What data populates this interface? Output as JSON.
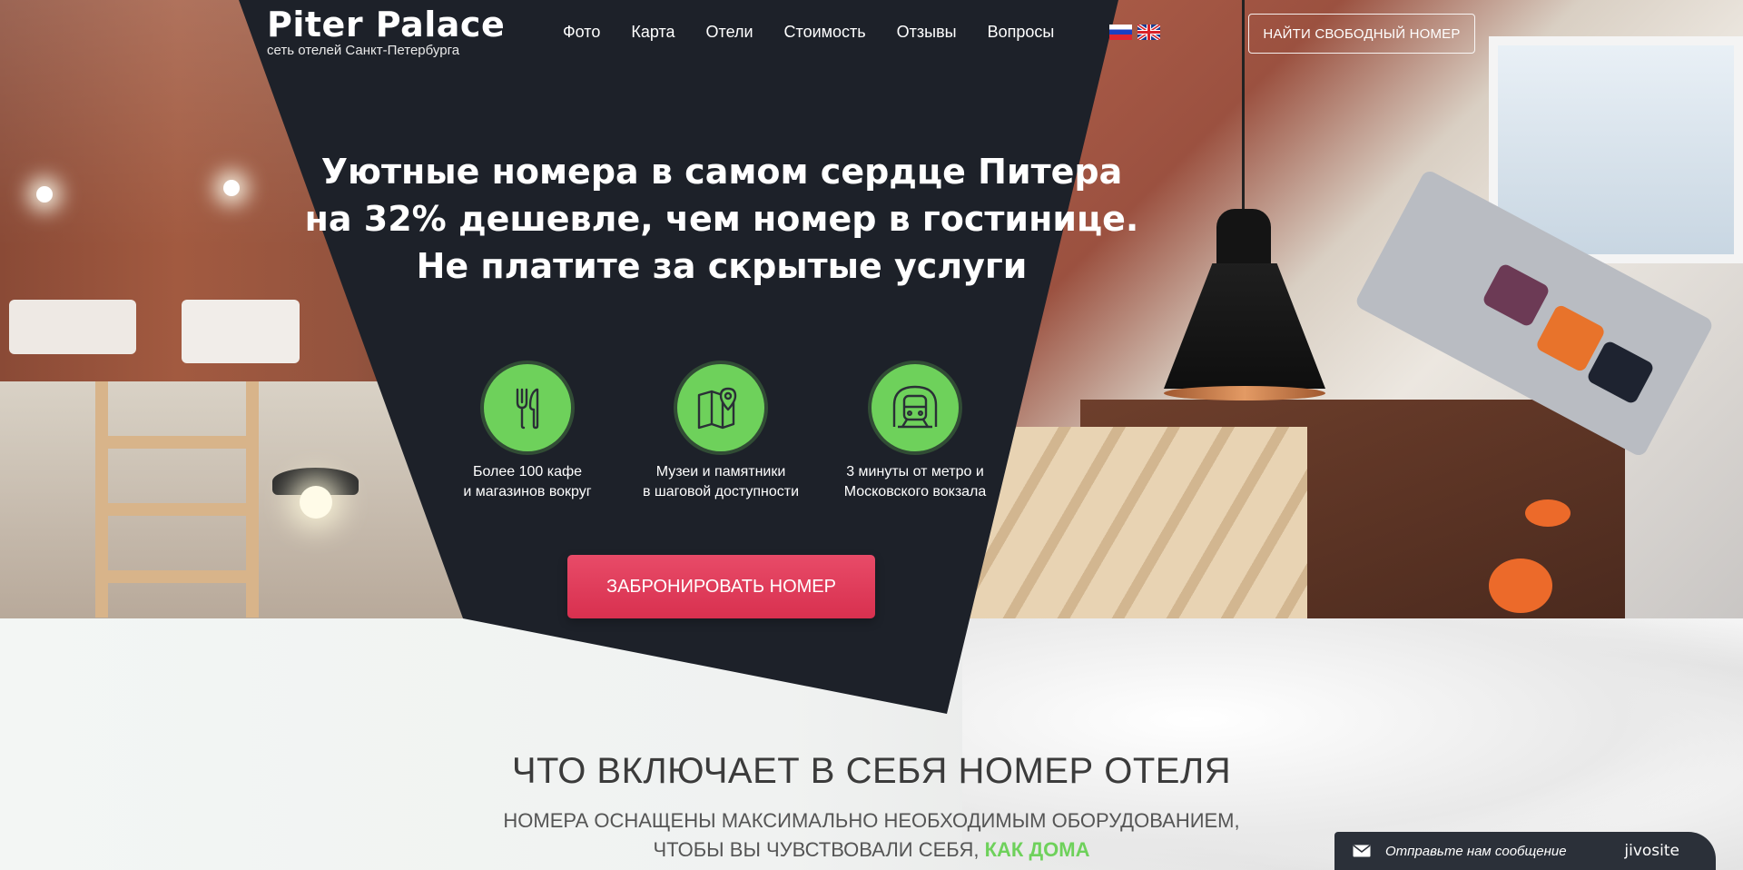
{
  "header": {
    "logo_title": "Piter Palace",
    "logo_subtitle": "сеть отелей Санкт-Петербурга",
    "nav": [
      {
        "label": "Фото"
      },
      {
        "label": "Карта"
      },
      {
        "label": "Отели"
      },
      {
        "label": "Стоимость"
      },
      {
        "label": "Отзывы"
      },
      {
        "label": "Вопросы"
      }
    ],
    "find_button": "НАЙТИ СВОБОДНЫЙ НОМЕР"
  },
  "hero": {
    "headline_lines": [
      "Уютные номера в самом сердце Питера",
      "на 32% дешевле, чем номер в гостинице.",
      "Не платите за скрытые услуги"
    ],
    "features": [
      {
        "icon": "fork-knife-icon",
        "lines": [
          "Более 100 кафе",
          "и магазинов вокруг"
        ]
      },
      {
        "icon": "map-pin-icon",
        "lines": [
          "Музеи и памятники",
          "в шаговой доступности"
        ]
      },
      {
        "icon": "metro-train-icon",
        "lines": [
          "3 минуты от метро и",
          "Московского вокзала"
        ]
      }
    ],
    "book_button": "ЗАБРОНИРОВАТЬ НОМЕР"
  },
  "section": {
    "title": "ЧТО ВКЛЮЧАЕТ В СЕБЯ НОМЕР ОТЕЛЯ",
    "subtitle_line1": "НОМЕРА ОСНАЩЕНЫ МАКСИМАЛЬНО НЕОБХОДИМЫМ ОБОРУДОВАНИЕМ,",
    "subtitle_line2": "ЧТОБЫ ВЫ ЧУВСТВОВАЛИ СЕБЯ,",
    "subtitle_highlight": "КАК ДОМА"
  },
  "chat": {
    "message": "Отправьте нам сообщение",
    "brand": "jivosite"
  },
  "colors": {
    "dark_panel": "#1d2129",
    "accent_green": "#6ed15b",
    "book_button": "#dc3655"
  }
}
